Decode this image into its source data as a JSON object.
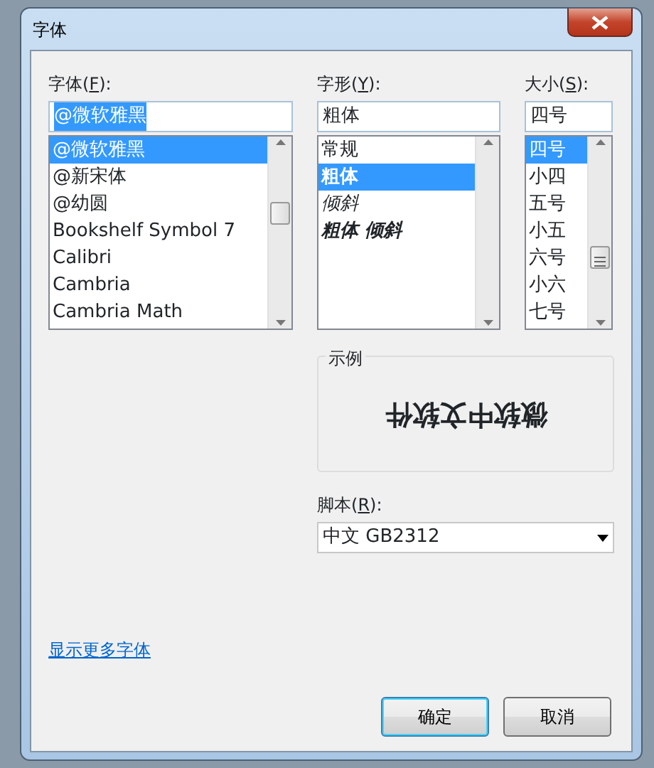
{
  "window": {
    "title": "字体"
  },
  "font": {
    "label": [
      "字体(",
      "F",
      "):"
    ],
    "value": "@微软雅黑",
    "value_selected": true,
    "items": [
      {
        "text": "@微软雅黑",
        "selected": true
      },
      {
        "text": "@新宋体",
        "selected": false
      },
      {
        "text": "@幼圆",
        "selected": false
      },
      {
        "text": "Bookshelf Symbol 7",
        "selected": false
      },
      {
        "text": "Calibri",
        "selected": false
      },
      {
        "text": "Cambria",
        "selected": false
      },
      {
        "text": "Cambria Math",
        "selected": false
      }
    ]
  },
  "style": {
    "label": [
      "字形(",
      "Y",
      "):"
    ],
    "value": "粗体",
    "items": [
      {
        "text": "常规",
        "kind": "regular",
        "selected": false
      },
      {
        "text": "粗体",
        "kind": "bold",
        "selected": true
      },
      {
        "text": "倾斜",
        "kind": "italic",
        "selected": false
      },
      {
        "text": "粗体 倾斜",
        "kind": "bold-italic",
        "selected": false
      }
    ]
  },
  "size": {
    "label": [
      "大小(",
      "S",
      "):"
    ],
    "value": "四号",
    "items": [
      {
        "text": "四号",
        "selected": true
      },
      {
        "text": "小四",
        "selected": false
      },
      {
        "text": "五号",
        "selected": false
      },
      {
        "text": "小五",
        "selected": false
      },
      {
        "text": "六号",
        "selected": false
      },
      {
        "text": "小六",
        "selected": false
      },
      {
        "text": "七号",
        "selected": false
      }
    ]
  },
  "sample": {
    "title": "示例",
    "text": "微软中文软件"
  },
  "script": {
    "label": [
      "脚本(",
      "R",
      "):"
    ],
    "value": "中文 GB2312"
  },
  "link": "显示更多字体",
  "buttons": [
    {
      "text": "确定",
      "default": true
    },
    {
      "text": "取消",
      "default": false
    }
  ]
}
